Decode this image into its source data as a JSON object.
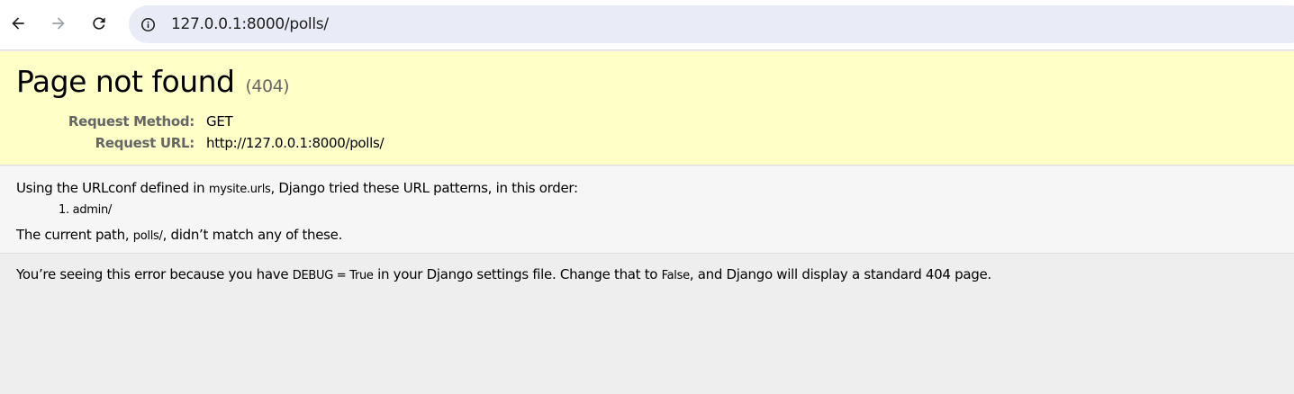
{
  "browser": {
    "url": "127.0.0.1:8000/polls/",
    "icons": {
      "back": "arrow-left-icon",
      "forward": "arrow-right-icon",
      "reload": "reload-icon",
      "site_info": "info-circle-icon"
    }
  },
  "summary": {
    "title": "Page not found",
    "status_code": "(404)",
    "request_method_label": "Request Method:",
    "request_method_value": "GET",
    "request_url_label": "Request URL:",
    "request_url_value": "http://127.0.0.1:8000/polls/"
  },
  "info": {
    "line1_prefix": "Using the URLconf defined in ",
    "urlconf": "mysite.urls",
    "line1_suffix": ", Django tried these URL patterns, in this order:",
    "patterns": [
      {
        "number": "1.",
        "pattern": "admin/"
      }
    ],
    "line2_prefix": "The current path, ",
    "current_path": "polls/",
    "line2_suffix": ", didn’t match any of these."
  },
  "explanation": {
    "part1": "You’re seeing this error because you have ",
    "debug_setting": "DEBUG = True",
    "part2": " in your Django settings file. Change that to ",
    "false_value": "False",
    "part3": ", and Django will display a standard 404 page."
  },
  "colors": {
    "summary_bg": "#ffffc8",
    "info_bg": "#f6f6f6",
    "explanation_bg": "#eeeeee",
    "omnibox_bg": "#e9ecf6"
  }
}
